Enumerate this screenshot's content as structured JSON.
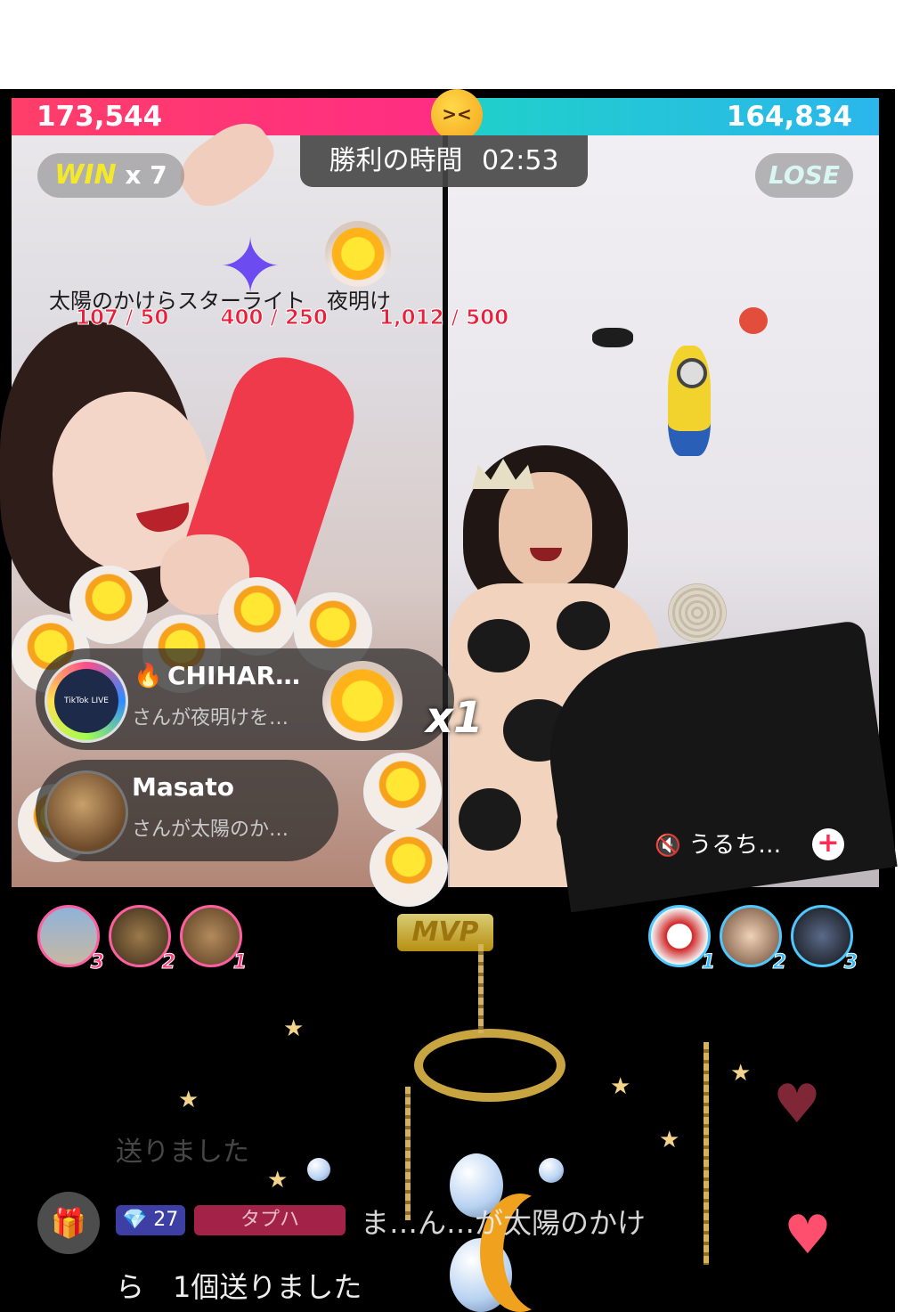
{
  "battle": {
    "left_score": "173,544",
    "right_score": "164,834",
    "timer_label": "勝利の時間",
    "timer_value": "02:53",
    "left_result": "WIN",
    "left_streak": "x 7",
    "right_result": "LOSE",
    "multiplier": "x1"
  },
  "gift_goals": {
    "names": "太陽のかけらスターライト　夜明け",
    "counts": [
      "107 / 50",
      "400 / 250",
      "1,012 / 500"
    ]
  },
  "comments": [
    {
      "name": "CHIHAR…",
      "text": "さんが夜明けを…"
    },
    {
      "name": "Masato",
      "text": "さんが太陽のか…"
    }
  ],
  "right_stream": {
    "user_label": "うるち…"
  },
  "leaderboard": {
    "left_ranks": [
      "3",
      "2",
      "1"
    ],
    "mvp_label": "MVP",
    "right_ranks": [
      "1",
      "2",
      "3"
    ]
  },
  "chat": {
    "faded_line": "送りました",
    "diamond_badge": "27",
    "tap_badge": "タプハ",
    "line1": "ま…ん…が太陽のかけ",
    "line2": "ら　1個送りました"
  },
  "colors": {
    "left_bar": "#ff3e69",
    "right_bar": "#2bb6ec",
    "win_text": "#f3e92a",
    "count_red": "#ec1e39"
  },
  "icons": [
    "emoji-face-icon",
    "flame-icon",
    "mute-icon",
    "plus-icon",
    "gift-icon",
    "diamond-icon",
    "heart-icon",
    "star-icon"
  ]
}
